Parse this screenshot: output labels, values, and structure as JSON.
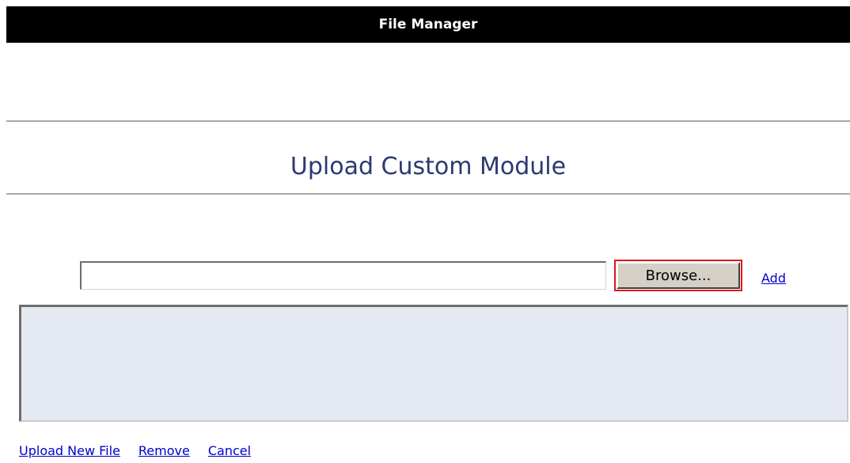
{
  "window": {
    "title": "File Manager"
  },
  "main": {
    "heading": "Upload Custom Module",
    "file_input": {
      "value": "",
      "placeholder": ""
    },
    "browse_label": "Browse...",
    "add_label": "Add",
    "file_list": []
  },
  "footer": {
    "links": {
      "upload_new_file": "Upload New File",
      "remove": "Remove",
      "cancel": "Cancel"
    }
  },
  "colors": {
    "title_bar_bg": "#000000",
    "heading_color": "#2b3a70",
    "link_color": "#0000cc",
    "highlight_border": "#e0121a",
    "list_bg": "#e4e9f2"
  }
}
